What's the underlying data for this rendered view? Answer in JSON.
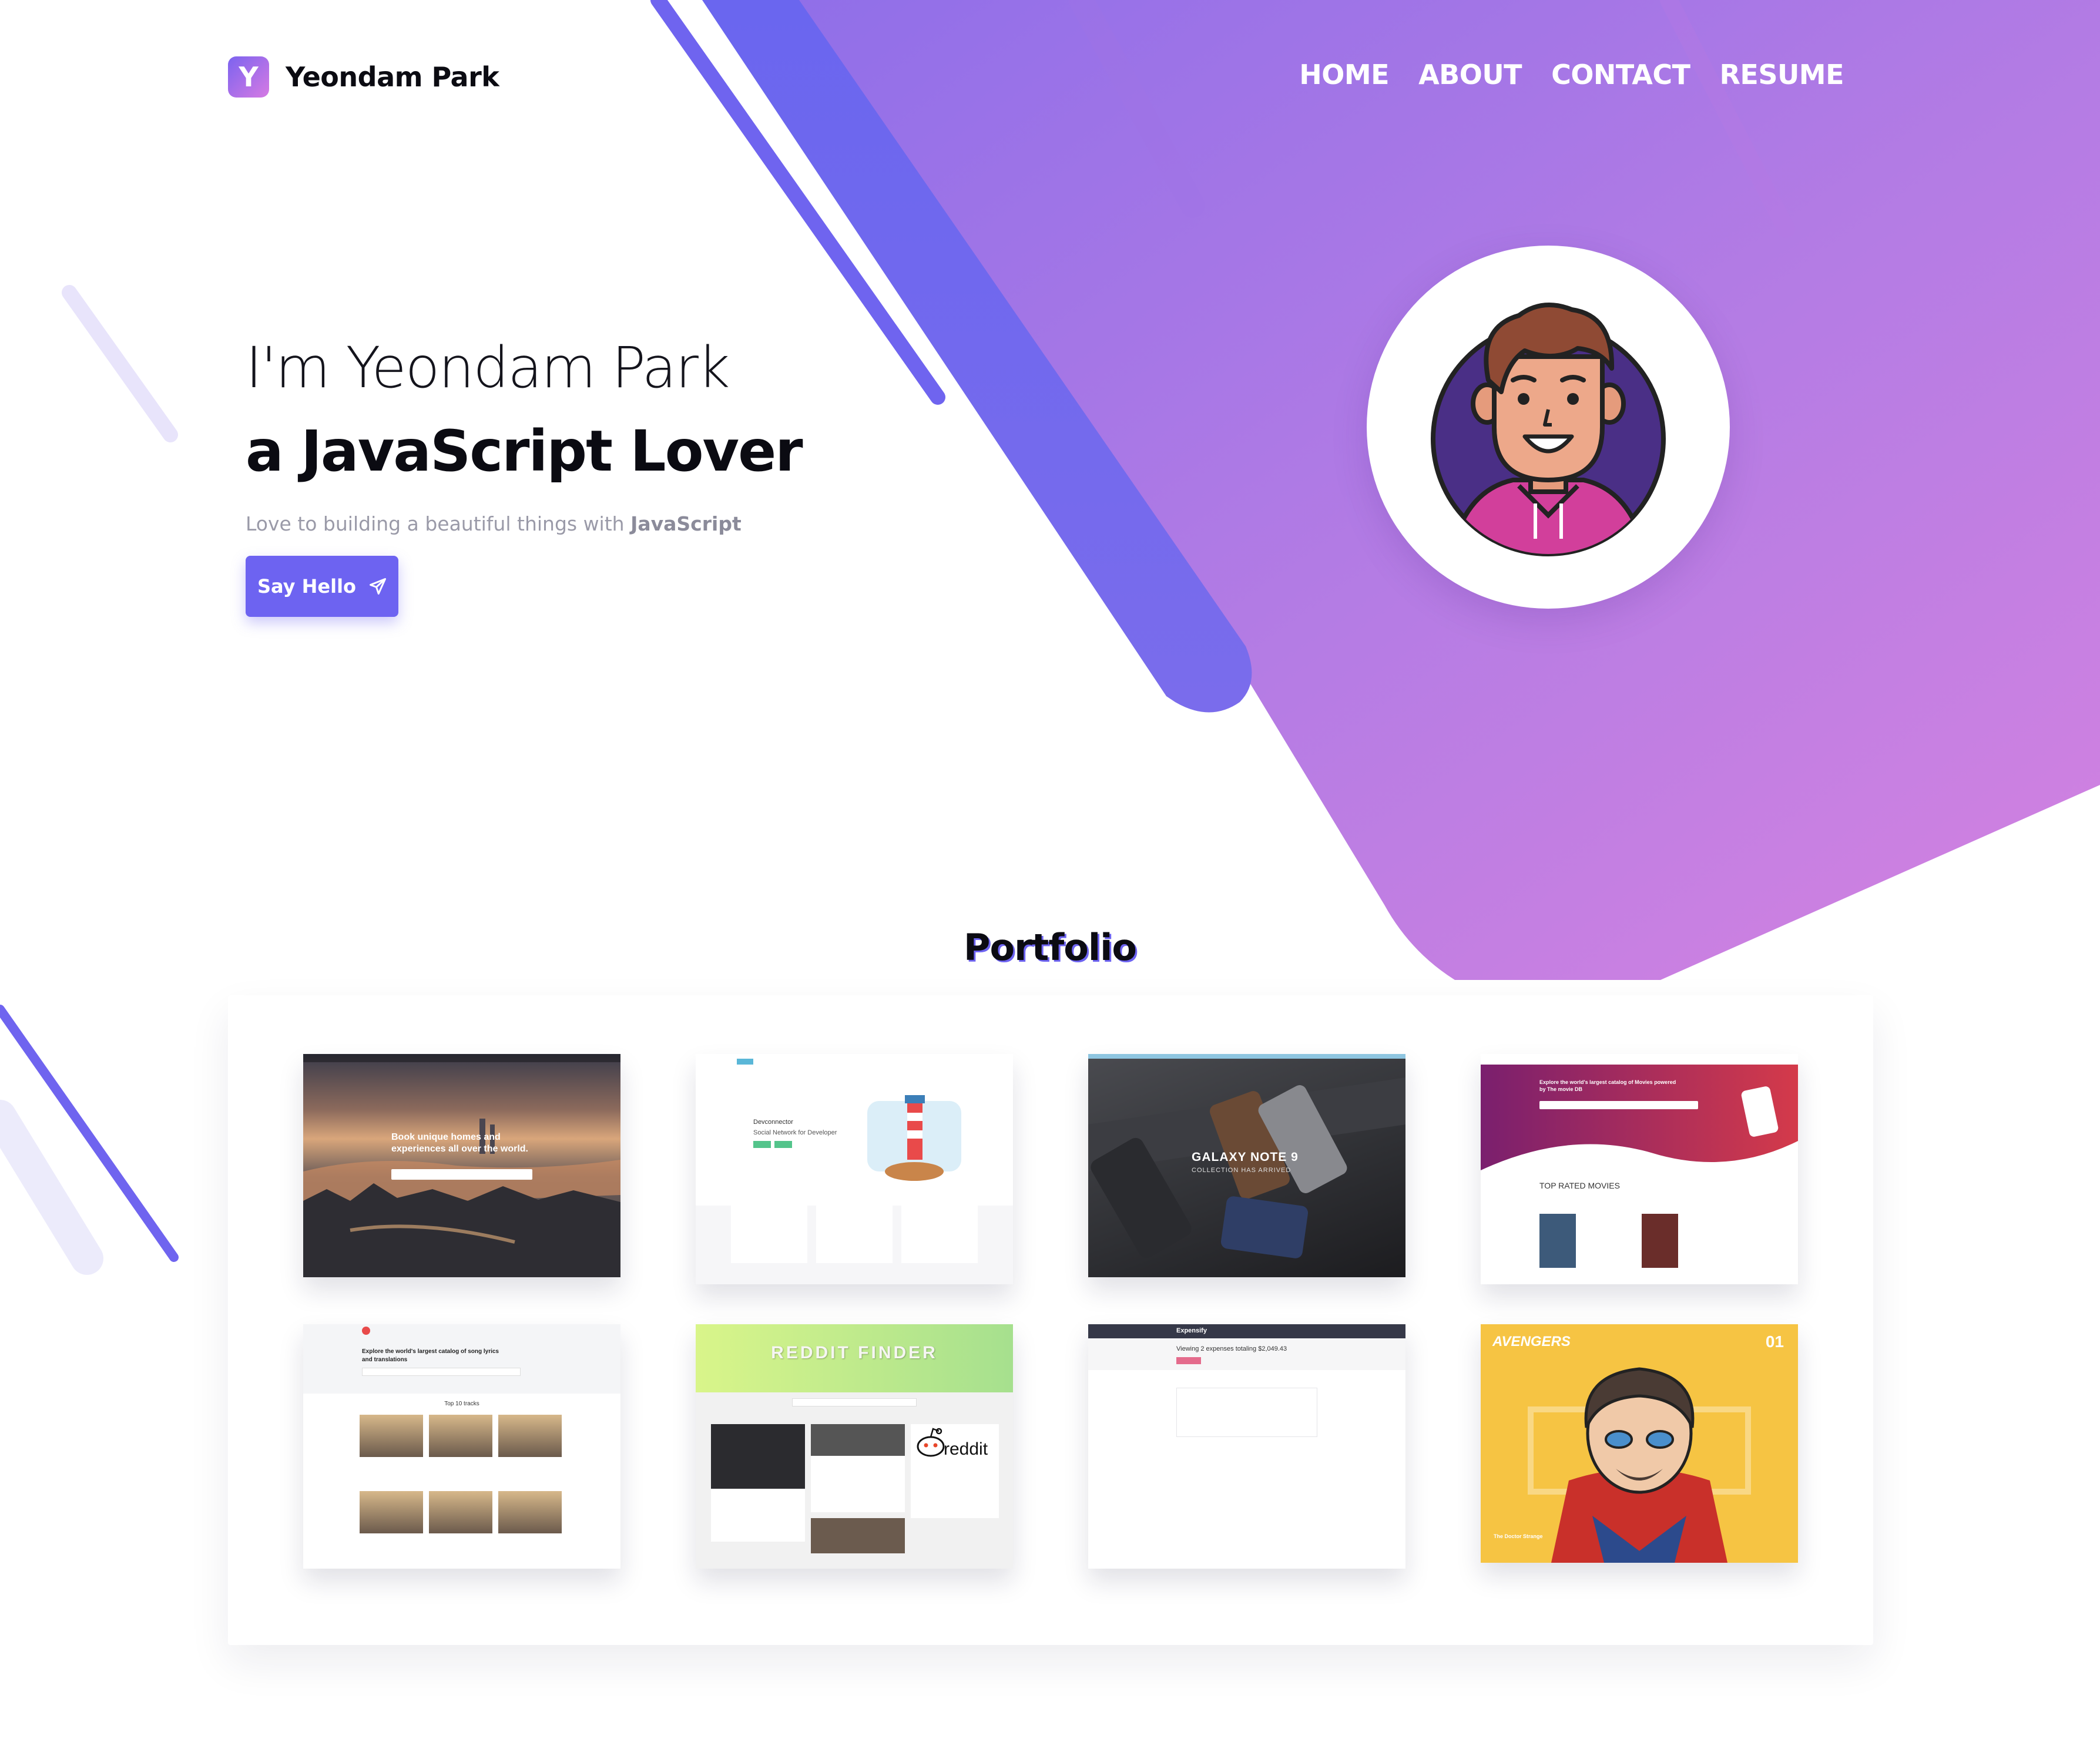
{
  "brand": {
    "initial": "Y",
    "name": "Yeondam Park"
  },
  "nav": {
    "items": [
      "HOME",
      "ABOUT",
      "CONTACT",
      "RESUME"
    ]
  },
  "hero": {
    "greeting": "I'm Yeondam Park",
    "tagline": "a JavaScript Lover",
    "subtitle_prefix": "Love to building a beautiful things with ",
    "subtitle_emphasis": "JavaScript",
    "cta_label": "Say Hello",
    "cta_icon": "paper-plane-icon"
  },
  "portfolio": {
    "title": "Portfolio",
    "projects": [
      {
        "name": "airbnb-clone",
        "headline": "Book unique homes and experiences all over the world."
      },
      {
        "name": "devconnector",
        "headline": "Devconnector",
        "subheadline": "Social Network for Developer"
      },
      {
        "name": "vrs-store",
        "headline": "GALAXY NOTE 9",
        "subheadline": "COLLECTION HAS ARRIVED"
      },
      {
        "name": "movie-finder",
        "headline": "Explore the world's largest catalog of Movies powered by The movie DB",
        "section": "TOP RATED MOVIES"
      },
      {
        "name": "lyrics-finder",
        "headline": "Explore the world's largest catalog of song lyrics and translations",
        "section": "Top 10 tracks"
      },
      {
        "name": "reddit-finder",
        "headline": "REDDIT FINDER",
        "logo_text": "reddit"
      },
      {
        "name": "expensify",
        "headline": "Expensify",
        "subheadline": "Viewing 2 expenses totaling $2,049.43"
      },
      {
        "name": "avengers",
        "headline": "AVENGERS",
        "number": "01",
        "subheadline": "The Doctor Strange"
      }
    ]
  },
  "colors": {
    "accent": "#6d63f1",
    "gradient_start": "#8a6cec",
    "gradient_end": "#d47ee2",
    "text_dark": "#0b0b12",
    "text_muted": "#9a9aa8"
  }
}
